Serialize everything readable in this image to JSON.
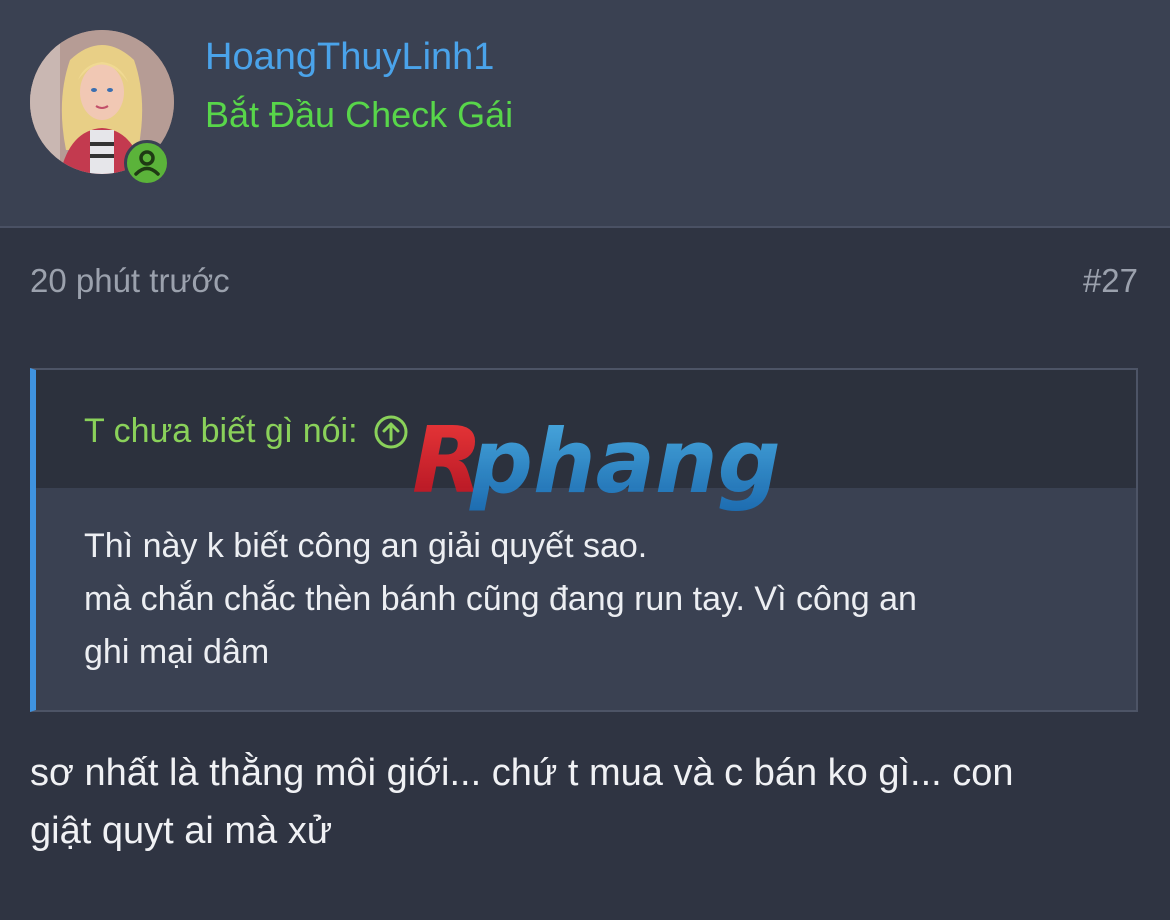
{
  "user": {
    "username": "HoangThuyLinh1",
    "title": "Bắt Đầu Check Gái",
    "avatar_icon": "doll-avatar",
    "status_icon": "online-user-icon"
  },
  "post": {
    "time": "20 phút trước",
    "number": "#27"
  },
  "quote": {
    "author": "T chưa biết gì nói:",
    "jump_icon": "arrow-up-circle-icon",
    "lines": [
      "Thì này k biết công an giải quyết sao.",
      "mà chắn chắc thèn bánh cũng đang run tay. Vì công an",
      "ghi mại dâm"
    ]
  },
  "body": {
    "lines": [
      "sơ nhất là thằng môi giới... chứ t mua và c bán ko gì... con",
      "giật quyt ai mà xử"
    ]
  },
  "watermark": {
    "text": "Rphang"
  },
  "colors": {
    "background": "#2f3442",
    "header": "#3a4152",
    "username": "#4aa3ea",
    "title": "#58d64a",
    "quote_border": "#3f93e0",
    "quote_author": "#8ad15a",
    "online": "#5bb33a"
  }
}
